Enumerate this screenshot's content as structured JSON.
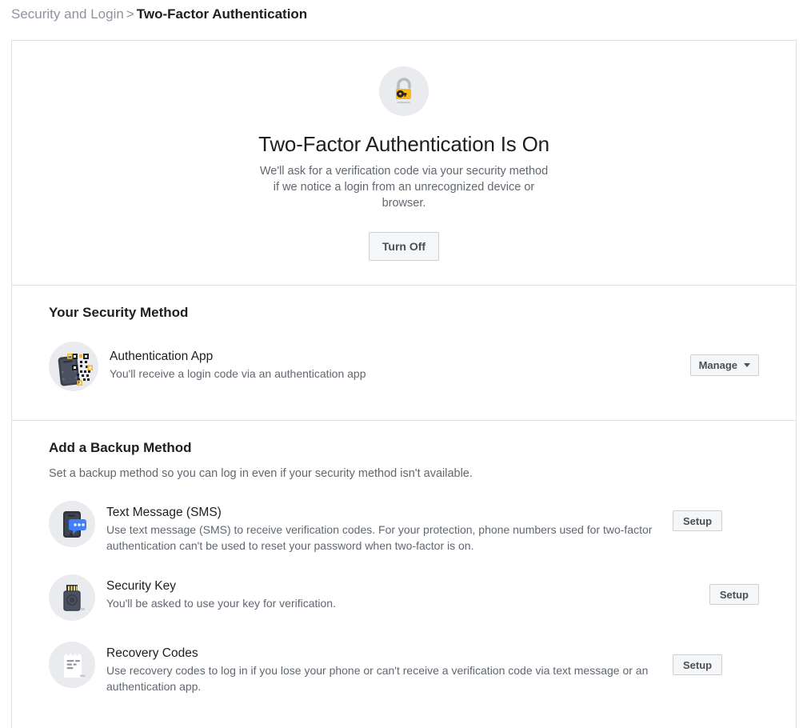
{
  "breadcrumb": {
    "parent": "Security and Login",
    "separator": ">",
    "current": "Two-Factor Authentication"
  },
  "status": {
    "icon": "unlocked-padlock-icon",
    "title": "Two-Factor Authentication Is On",
    "description": "We'll ask for a verification code via your security method if we notice a login from an unrecognized device or browser.",
    "turn_off_label": "Turn Off"
  },
  "security_method": {
    "heading": "Your Security Method",
    "items": [
      {
        "icon": "authenticator-qr-phone-icon",
        "name": "Authentication App",
        "description": "You'll receive a login code via an authentication app",
        "action_label": "Manage",
        "action_has_caret": true
      }
    ]
  },
  "backup_method": {
    "heading": "Add a Backup Method",
    "subtitle": "Set a backup method so you can log in even if your security method isn't available.",
    "items": [
      {
        "icon": "sms-phone-chat-icon",
        "name": "Text Message (SMS)",
        "description": "Use text message (SMS) to receive verification codes. For your protection, phone numbers used for two-factor authentication can't be used to reset your password when two-factor is on.",
        "action_label": "Setup"
      },
      {
        "icon": "usb-security-key-icon",
        "name": "Security Key",
        "description": "You'll be asked to use your key for verification.",
        "action_label": "Setup"
      },
      {
        "icon": "recovery-codes-paper-icon",
        "name": "Recovery Codes",
        "description": "Use recovery codes to log in if you lose your phone or can't receive a verification code via text message or an authentication app.",
        "action_label": "Setup"
      }
    ]
  },
  "colors": {
    "accent_yellow": "#f7b928",
    "accent_blue": "#4080ff",
    "icon_dark": "#3a3f4b",
    "border": "#dddfe2",
    "text_secondary": "#606770",
    "button_bg": "#f5f6f7"
  }
}
